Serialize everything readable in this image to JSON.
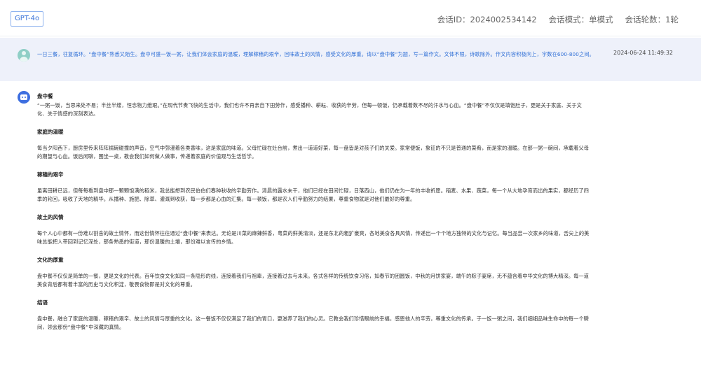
{
  "header": {
    "model_tag": "GPT-4o",
    "session_id": "会话ID：2024002534142",
    "session_mode": "会话模式：单模式",
    "session_rounds": "会话轮数：1轮"
  },
  "user_message": {
    "avatar_icon": "user-avatar-icon",
    "text": "一日三餐，往复循环。“盘中餐”熟悉又陌生。盘中可盛一饭一粥，让我们体会家庭的温暖，理解稼穑的艰辛，回味故土的风情，感受文化的厚重。请以“盘中餐”为题，写一篇作文。文体不限，诗歌除外。作文内容积极向上，字数在600-800之间。",
    "timestamp": "2024-06-24 11:49:32"
  },
  "assistant_message": {
    "avatar_icon": "bot-avatar-icon",
    "title": "盘中餐",
    "intro": "“一粥一饭，当思来处不易；半丝半缕，恒念物力维艰。”在现代节奏飞快的生活中，我们也许不再亲自下田劳作，感受播种、耕耘、收获的辛劳，但每一顿饭，仍承载着数不尽的汗水与心血。“盘中餐”不仅仅是填饱肚子，更是关于家庭、关于文化、关于情感的深刻表达。",
    "sections": [
      {
        "heading": "家庭的温暖",
        "body": "每当夕阳西下，厨房里传来阵阵锅碗碰撞的声音，空气中弥漫着各类香味，这是家庭的味道。父母忙碌在灶台前，煮出一道道好菜，每一盘皆是对孩子们的关爱。家常便饭，象征的不只是普通的菜肴，而是家的温暖。在那一粥一碗间，承载着父母的期望与心血。饭后闲聊，围坐一桌，教会我们如何做人做事，传递着家庭的价值观与生活哲学。"
      },
      {
        "heading": "稼穑的艰辛",
        "body": "虽离田耕已远，但每每看到盘中那一颗颗饱满的稻米，我总能想到农民伯伯们春种秋收的辛勤劳作。清晨的露水未干，他们已经在田间忙碌，日落西山，他们仍在为一年的丰收祈愿。稻麦、水果、蔬菜，每一个从大地孕育而出的果实，都经历了四季的轮回，吸收了天地的精华。从播种、施肥、除草、灌溉到收获，每一步都是心血的汇集。每一顿饭，都是农人们辛勤努力的结果，尊重食物就是对他们最好的尊重。"
      },
      {
        "heading": "故土的风情",
        "body": "每个人心中都有一份难以割舍的故土情怀，而这份情怀往往通过“盘中餐”来表达。无论是川菜的麻辣鲜香，粤菜的鲜美清淡，还是东北的粗犷豪爽，各地美食各具风情，传递出一个个地方独特的文化与记忆。每当品尝一次家乡的味道，舌尖上的美味总能把人带回到记忆深处，那条熟悉的街道，那份温暖的土壤，那份难以言传的乡情。"
      },
      {
        "heading": "文化的厚重",
        "body": "盘中餐不仅仅是简单的一餐，更是文化的代表。百年饮食文化如同一条隐形的线，连接着我们与祖辈，连接着过去与未来。各式各样的传统饮食习俗，如春节的团圆饭，中秋的月饼家宴，端午的粽子宴席，无不蕴含着中华文化的博大精深。每一道美食背后都有着丰富的历史与文化积淀，敬畏食物即是对文化的尊重。"
      },
      {
        "heading": "结语",
        "body": "盘中餐，融合了家庭的温暖、稼穑的艰辛、故土的风情与厚重的文化。这一餐饭不仅仅满足了我们的胃口，更滋养了我们的心灵。它教会我们珍惜眼前的幸福，感恩他人的辛劳，尊重文化的传承。于一饭一粥之间，我们细细品味生命中的每一个瞬间，领会那份“盘中餐”中深藏的真情。"
      }
    ]
  }
}
